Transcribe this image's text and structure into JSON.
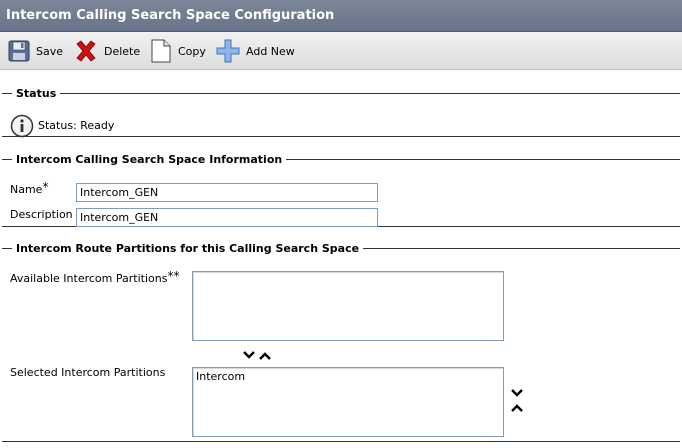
{
  "window": {
    "title": "Intercom Calling Search Space Configuration"
  },
  "toolbar": {
    "save_label": "Save",
    "delete_label": "Delete",
    "copy_label": "Copy",
    "add_new_label": "Add New"
  },
  "status": {
    "legend": "Status",
    "text": "Status: Ready",
    "icon": "info-icon"
  },
  "info": {
    "legend": "Intercom Calling Search Space Information",
    "name_label": "Name",
    "name_value": "Intercom_GEN",
    "description_label": "Description",
    "description_value": "Intercom_GEN",
    "required_marker": "*"
  },
  "partitions": {
    "legend": "Intercom Route Partitions for this Calling Search Space",
    "available_label": "Available Intercom Partitions",
    "available_marker": "**",
    "available_items": [],
    "selected_label": "Selected Intercom Partitions",
    "selected_items": [
      "Intercom"
    ]
  },
  "colors": {
    "titlebar": "#68728a",
    "delete_icon": "#cc1111",
    "add_icon": "#3a78c8"
  }
}
